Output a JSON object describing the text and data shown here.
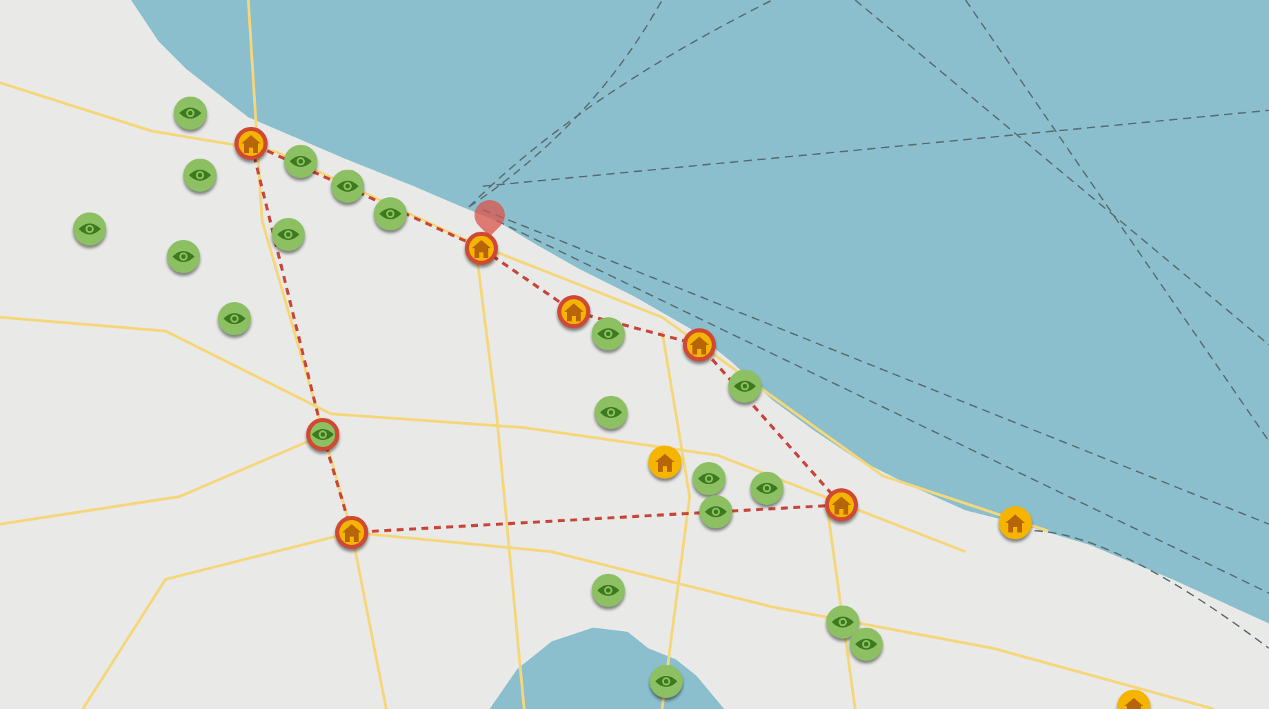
{
  "map": {
    "markers": [
      {
        "kind": "house",
        "on_route": true
      },
      {
        "kind": "eye",
        "on_route": true
      },
      {
        "kind": "house",
        "on_route": true
      },
      {
        "kind": "house",
        "on_route": true
      },
      {
        "kind": "house",
        "on_route": true
      },
      {
        "kind": "house",
        "on_route": true
      },
      {
        "kind": "house",
        "on_route": true
      },
      {
        "kind": "house",
        "on_route": false
      },
      {
        "kind": "house",
        "on_route": false
      },
      {
        "kind": "house",
        "on_route": false
      },
      {
        "kind": "eye",
        "on_route": false
      },
      {
        "kind": "eye",
        "on_route": false
      },
      {
        "kind": "eye",
        "on_route": false
      },
      {
        "kind": "eye",
        "on_route": false
      },
      {
        "kind": "eye",
        "on_route": false
      },
      {
        "kind": "eye",
        "on_route": false
      },
      {
        "kind": "eye",
        "on_route": false
      },
      {
        "kind": "eye",
        "on_route": false
      },
      {
        "kind": "eye",
        "on_route": false
      },
      {
        "kind": "eye",
        "on_route": false
      },
      {
        "kind": "eye",
        "on_route": false
      },
      {
        "kind": "eye",
        "on_route": false
      },
      {
        "kind": "eye",
        "on_route": false
      },
      {
        "kind": "eye",
        "on_route": false
      },
      {
        "kind": "eye",
        "on_route": false
      },
      {
        "kind": "eye",
        "on_route": false
      },
      {
        "kind": "eye",
        "on_route": false
      },
      {
        "kind": "eye",
        "on_route": false
      },
      {
        "kind": "eye",
        "on_route": false
      }
    ]
  }
}
